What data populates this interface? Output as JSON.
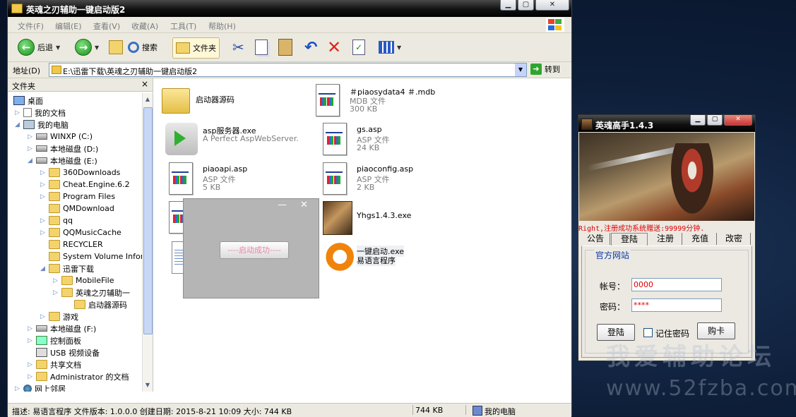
{
  "explorer": {
    "title": "英魂之刃辅助一键启动版2",
    "menu": [
      "文件(F)",
      "编辑(E)",
      "查看(V)",
      "收藏(A)",
      "工具(T)",
      "帮助(H)"
    ],
    "toolbar": {
      "back": "后退",
      "search": "搜索",
      "folders": "文件夹"
    },
    "address": {
      "label": "地址(D)",
      "value": "E:\\迅雷下载\\英魂之刃辅助一键启动版2",
      "go": "转到"
    },
    "tree_header": "文件夹",
    "tree_close": "×",
    "tree": [
      {
        "label": "桌面",
        "icon": "desktop-icon"
      },
      {
        "label": "我的文档",
        "icon": "documents-icon"
      },
      {
        "label": "我的电脑",
        "icon": "computer-icon"
      },
      {
        "label": "WINXP (C:)",
        "icon": "drive-icon"
      },
      {
        "label": "本地磁盘 (D:)",
        "icon": "drive-icon"
      },
      {
        "label": "本地磁盘 (E:)",
        "icon": "drive-icon"
      },
      {
        "label": "360Downloads",
        "icon": "folder-icon"
      },
      {
        "label": "Cheat.Engine.6.2",
        "icon": "folder-icon"
      },
      {
        "label": "Program Files",
        "icon": "folder-icon"
      },
      {
        "label": "QMDownload",
        "icon": "folder-icon"
      },
      {
        "label": "qq",
        "icon": "folder-icon"
      },
      {
        "label": "QQMusicCache",
        "icon": "folder-icon"
      },
      {
        "label": "RECYCLER",
        "icon": "folder-icon"
      },
      {
        "label": "System Volume Inform",
        "icon": "folder-icon"
      },
      {
        "label": "迅雷下载",
        "icon": "folder-icon"
      },
      {
        "label": "MobileFile",
        "icon": "folder-icon"
      },
      {
        "label": "英魂之刃辅助一",
        "icon": "folder-icon"
      },
      {
        "label": "启动器源码",
        "icon": "folder-icon"
      },
      {
        "label": "游戏",
        "icon": "folder-icon"
      },
      {
        "label": "本地磁盘 (F:)",
        "icon": "drive-icon"
      },
      {
        "label": "控制面板",
        "icon": "control-panel-icon"
      },
      {
        "label": "USB 视频设备",
        "icon": "usb-icon"
      },
      {
        "label": "共享文档",
        "icon": "folder-icon"
      },
      {
        "label": "Administrator 的文档",
        "icon": "folder-icon"
      },
      {
        "label": "网上邻居",
        "icon": "network-icon"
      }
    ],
    "files": [
      {
        "name": "启动器源码",
        "type": "",
        "size": "",
        "icon": "folder-icon"
      },
      {
        "name": "＃piaosydata4 ＃.mdb",
        "type": "MDB 文件",
        "size": "300 KB",
        "icon": "document-icon"
      },
      {
        "name": "asp服务器.exe",
        "type": "A Perfect AspWebServer.",
        "size": "",
        "icon": "play-icon"
      },
      {
        "name": "gs.asp",
        "type": "ASP 文件",
        "size": "24 KB",
        "icon": "document-icon"
      },
      {
        "name": "piaoapi.asp",
        "type": "ASP 文件",
        "size": "5 KB",
        "icon": "document-icon"
      },
      {
        "name": "piaoconfig.asp",
        "type": "ASP 文件",
        "size": "2 KB",
        "icon": "document-icon"
      },
      {
        "name": "",
        "type": "",
        "size": "",
        "icon": "document-icon"
      },
      {
        "name": "Yhgs1.4.3.exe",
        "type": "",
        "size": "",
        "icon": "game-exe-icon"
      },
      {
        "name": "",
        "type": "",
        "size": "",
        "icon": "notepad-icon"
      },
      {
        "name": "一键启动.exe",
        "type": "易语言程序",
        "size": "",
        "icon": "e-language-icon"
      }
    ],
    "status": {
      "desc": "描述: 易语言程序 文件版本: 1.0.0.0 创建日期: 2015-8-21 10:09 大小: 744 KB",
      "size": "744 KB",
      "location": "我的电脑"
    }
  },
  "popup": {
    "button": "----启动成功----",
    "minimize": "—",
    "close": "✕"
  },
  "game": {
    "title": "英魂高手1.4.3",
    "notice": "Right,注册成功系统赠送:99999分钟.",
    "tabs": [
      "公告",
      "登陆",
      "注册",
      "充值",
      "改密"
    ],
    "active_tab": "登陆",
    "group": "官方网站",
    "account_label": "帐号：",
    "account_value": "0000",
    "password_label": "密码：",
    "password_value": "****",
    "login_button": "登陆",
    "remember": "记住密码",
    "buy_button": "购卡"
  },
  "watermark": {
    "line1": "我爱辅助论坛",
    "line2": "www.52fzba.com"
  },
  "colors": {
    "accent_red": "#e00000",
    "link_blue": "#0b3aa8",
    "popup_text": "#e784a8"
  }
}
